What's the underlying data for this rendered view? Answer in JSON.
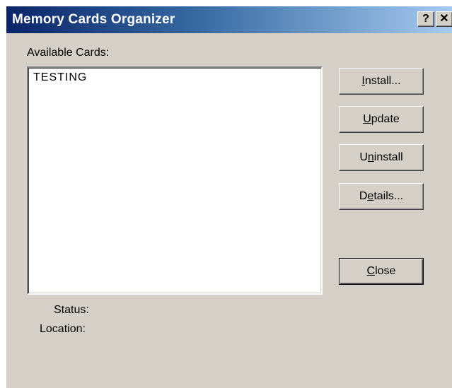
{
  "window": {
    "title": "Memory Cards Organizer",
    "help_button": "?",
    "close_button": "✕"
  },
  "available_cards": {
    "label": "Available Cards:",
    "items": [
      "TESTING"
    ]
  },
  "buttons": {
    "install": {
      "mnemonic": "I",
      "rest": "nstall..."
    },
    "update": {
      "mnemonic": "U",
      "rest": "pdate"
    },
    "uninstall": {
      "pre": "U",
      "mnemonic": "n",
      "rest": "install"
    },
    "details": {
      "pre": "D",
      "mnemonic": "e",
      "rest": "tails..."
    },
    "close": {
      "mnemonic": "C",
      "rest": "lose"
    }
  },
  "status": {
    "status_label": "Status:",
    "location_label": "Location:"
  }
}
